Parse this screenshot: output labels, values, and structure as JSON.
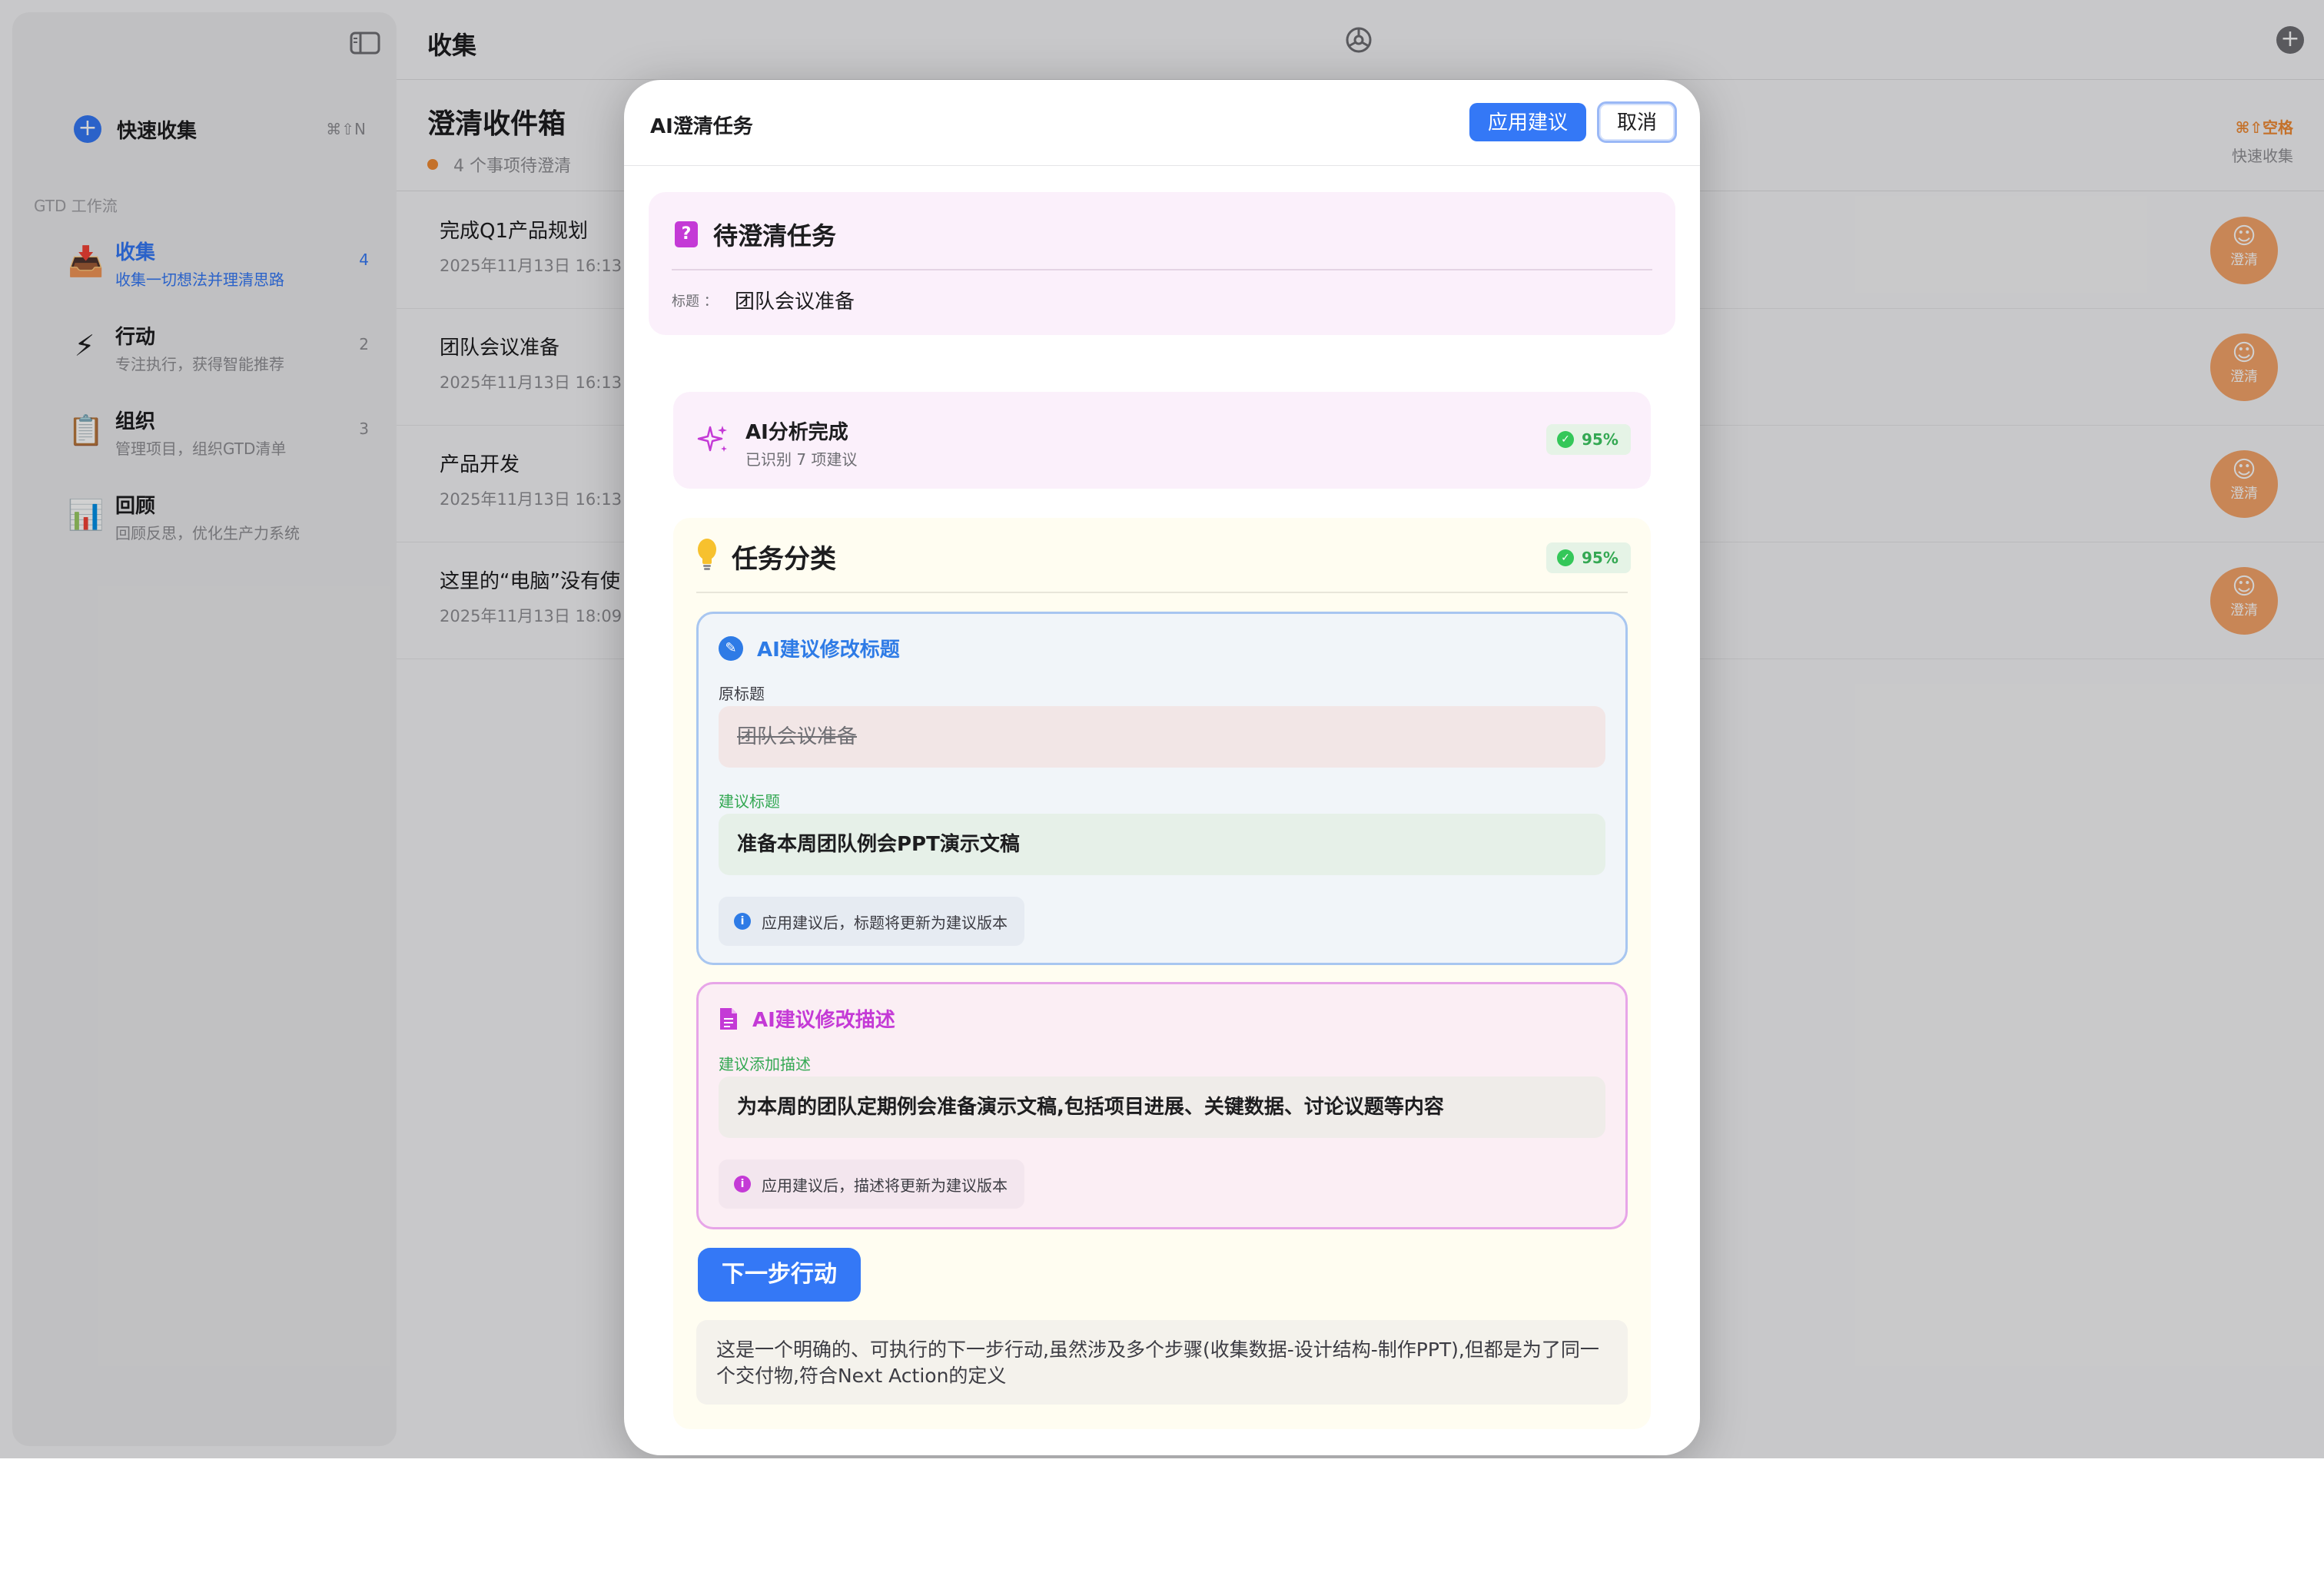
{
  "sidebar": {
    "quick_capture": {
      "label": "快速收集",
      "shortcut": "⌘⇧N"
    },
    "section_label": "GTD 工作流",
    "items": [
      {
        "title": "收集",
        "subtitle": "收集一切想法并理清思路",
        "count": "4",
        "icon": "inbox-tray-icon"
      },
      {
        "title": "行动",
        "subtitle": "专注执行，获得智能推荐",
        "count": "2",
        "icon": "lightning-icon"
      },
      {
        "title": "组织",
        "subtitle": "管理项目，组织GTD清单",
        "count": "3",
        "icon": "clipboard-icon"
      },
      {
        "title": "回顾",
        "subtitle": "回顾反思，优化生产力系统",
        "count": "",
        "icon": "bar-chart-icon"
      }
    ]
  },
  "topbar": {
    "title": "收集"
  },
  "inbox": {
    "title": "澄清收件箱",
    "subtitle": "4 个事项待澄清",
    "hotkey": "⌘⇧空格",
    "hotkey_label": "快速收集",
    "clarify_label": "澄清",
    "tasks": [
      {
        "title": "完成Q1产品规划",
        "date": "2025年11月13日 16:13"
      },
      {
        "title": "团队会议准备",
        "date": "2025年11月13日 16:13"
      },
      {
        "title": "产品开发",
        "date": "2025年11月13日 16:13"
      },
      {
        "title": "这里的“电脑”没有使",
        "date": "2025年11月13日 18:09"
      }
    ]
  },
  "modal": {
    "title": "AI澄清任务",
    "apply_label": "应用建议",
    "cancel_label": "取消",
    "pending": {
      "title": "待澄清任务",
      "key": "标题 ：",
      "value": "团队会议准备"
    },
    "analysis": {
      "title": "AI分析完成",
      "subtitle": "已识别 7 项建议",
      "confidence": "95%"
    },
    "category": {
      "title": "任务分类",
      "confidence": "95%",
      "title_suggestion": {
        "heading": "AI建议修改标题",
        "original_label": "原标题",
        "original": "团队会议准备",
        "suggested_label": "建议标题",
        "suggested": "准备本周团队例会PPT演示文稿",
        "note": "应用建议后，标题将更新为建议版本"
      },
      "desc_suggestion": {
        "heading": "AI建议修改描述",
        "label": "建议添加描述",
        "value": "为本周的团队定期例会准备演示文稿,包括项目进展、关键数据、讨论议题等内容",
        "note": "应用建议后，描述将更新为建议版本"
      },
      "next_action_label": "下一步行动",
      "reason": "这是一个明确的、可执行的下一步行动,虽然涉及多个步骤(收集数据-设计结构-制作PPT),但都是为了同一个交付物,符合Next Action的定义"
    }
  },
  "colors": {
    "accent": "#3478f6",
    "magenta": "#c43ad6",
    "success": "#34c759",
    "orange": "#f08a34"
  }
}
